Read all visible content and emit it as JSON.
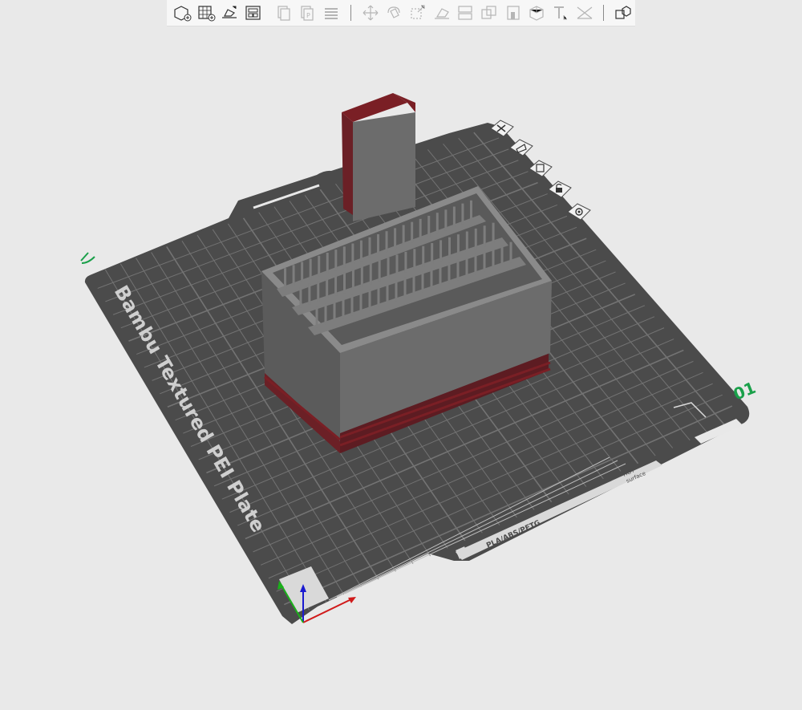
{
  "app": {
    "view": "3D Prepare viewport"
  },
  "toolbar": {
    "groups": [
      {
        "items": [
          {
            "icon": "add-object-icon",
            "tooltip": ""
          },
          {
            "icon": "add-plate-icon",
            "tooltip": ""
          },
          {
            "icon": "auto-orient-icon",
            "tooltip": ""
          },
          {
            "icon": "arrange-icon",
            "tooltip": ""
          },
          {
            "icon": "copy-icon",
            "tooltip": ""
          },
          {
            "icon": "paste-icon",
            "tooltip": ""
          },
          {
            "icon": "layers-icon",
            "tooltip": ""
          }
        ]
      },
      {
        "items": [
          {
            "icon": "move-icon",
            "tooltip": ""
          },
          {
            "icon": "rotate-icon",
            "tooltip": ""
          },
          {
            "icon": "scale-icon",
            "tooltip": ""
          },
          {
            "icon": "lay-on-face-icon",
            "tooltip": ""
          },
          {
            "icon": "cut-icon",
            "tooltip": ""
          },
          {
            "icon": "boolean-icon",
            "tooltip": ""
          },
          {
            "icon": "support-paint-icon",
            "tooltip": ""
          },
          {
            "icon": "seam-paint-icon",
            "tooltip": ""
          },
          {
            "icon": "text-icon",
            "tooltip": ""
          },
          {
            "icon": "measure-icon",
            "tooltip": ""
          }
        ]
      },
      {
        "items": [
          {
            "icon": "assembly-view-icon",
            "tooltip": ""
          }
        ]
      }
    ]
  },
  "plate": {
    "name": "Bambu Textured PEI Plate",
    "number": "01",
    "compat_label": "PLA/ABS/PETG",
    "hot_label_line1": "HOT",
    "hot_label_line2": "surface",
    "colors": {
      "plate": "#4b4b4b",
      "grid": "#7a7a7a",
      "text": "#d9d9d9",
      "number": "#1aa04a",
      "background": "#e9e9e9"
    }
  },
  "plate_buttons": [
    {
      "icon": "delete-plate-icon"
    },
    {
      "icon": "auto-orient-plate-icon"
    },
    {
      "icon": "arrange-plate-icon"
    },
    {
      "icon": "lock-plate-icon"
    },
    {
      "icon": "plate-settings-icon"
    }
  ],
  "model": {
    "primary_color": "#6a6a6a",
    "accent_color": "#7a1f25"
  },
  "axes": {
    "x_color": "#d01a1a",
    "y_color": "#1ab01a",
    "z_color": "#1a1ad0"
  }
}
